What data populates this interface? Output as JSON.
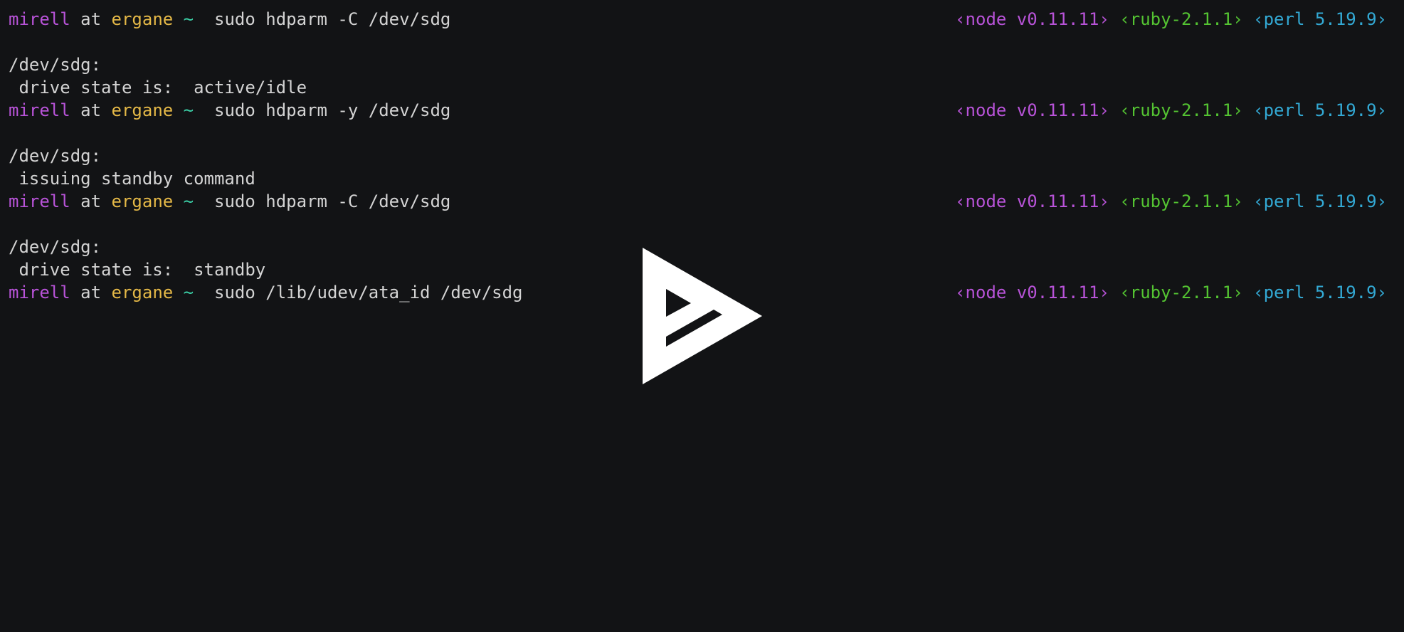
{
  "prompt": {
    "user": "mirell",
    "at": "at",
    "host": "ergane",
    "dir": "~"
  },
  "rprompt": {
    "node": "‹node v0.11.11›",
    "ruby": "‹ruby-2.1.1›",
    "perl": "‹perl 5.19.9›"
  },
  "commands": [
    "sudo hdparm -C /dev/sdg",
    "sudo hdparm -y /dev/sdg",
    "sudo hdparm -C /dev/sdg",
    "sudo /lib/udev/ata_id /dev/sdg"
  ],
  "outputs": {
    "o1": [
      "/dev/sdg:",
      " drive state is:  active/idle"
    ],
    "o2": [
      "/dev/sdg:",
      " issuing standby command"
    ],
    "o3": [
      "/dev/sdg:",
      " drive state is:  standby"
    ]
  },
  "overlay": {
    "icon": "asciinema-play-icon",
    "color": "#ffffff"
  },
  "colors": {
    "background": "#121315",
    "user": "#b853d8",
    "host": "#e4b847",
    "tilde": "#3bcfa6",
    "ruby": "#54c432",
    "perl": "#33a9d4"
  }
}
